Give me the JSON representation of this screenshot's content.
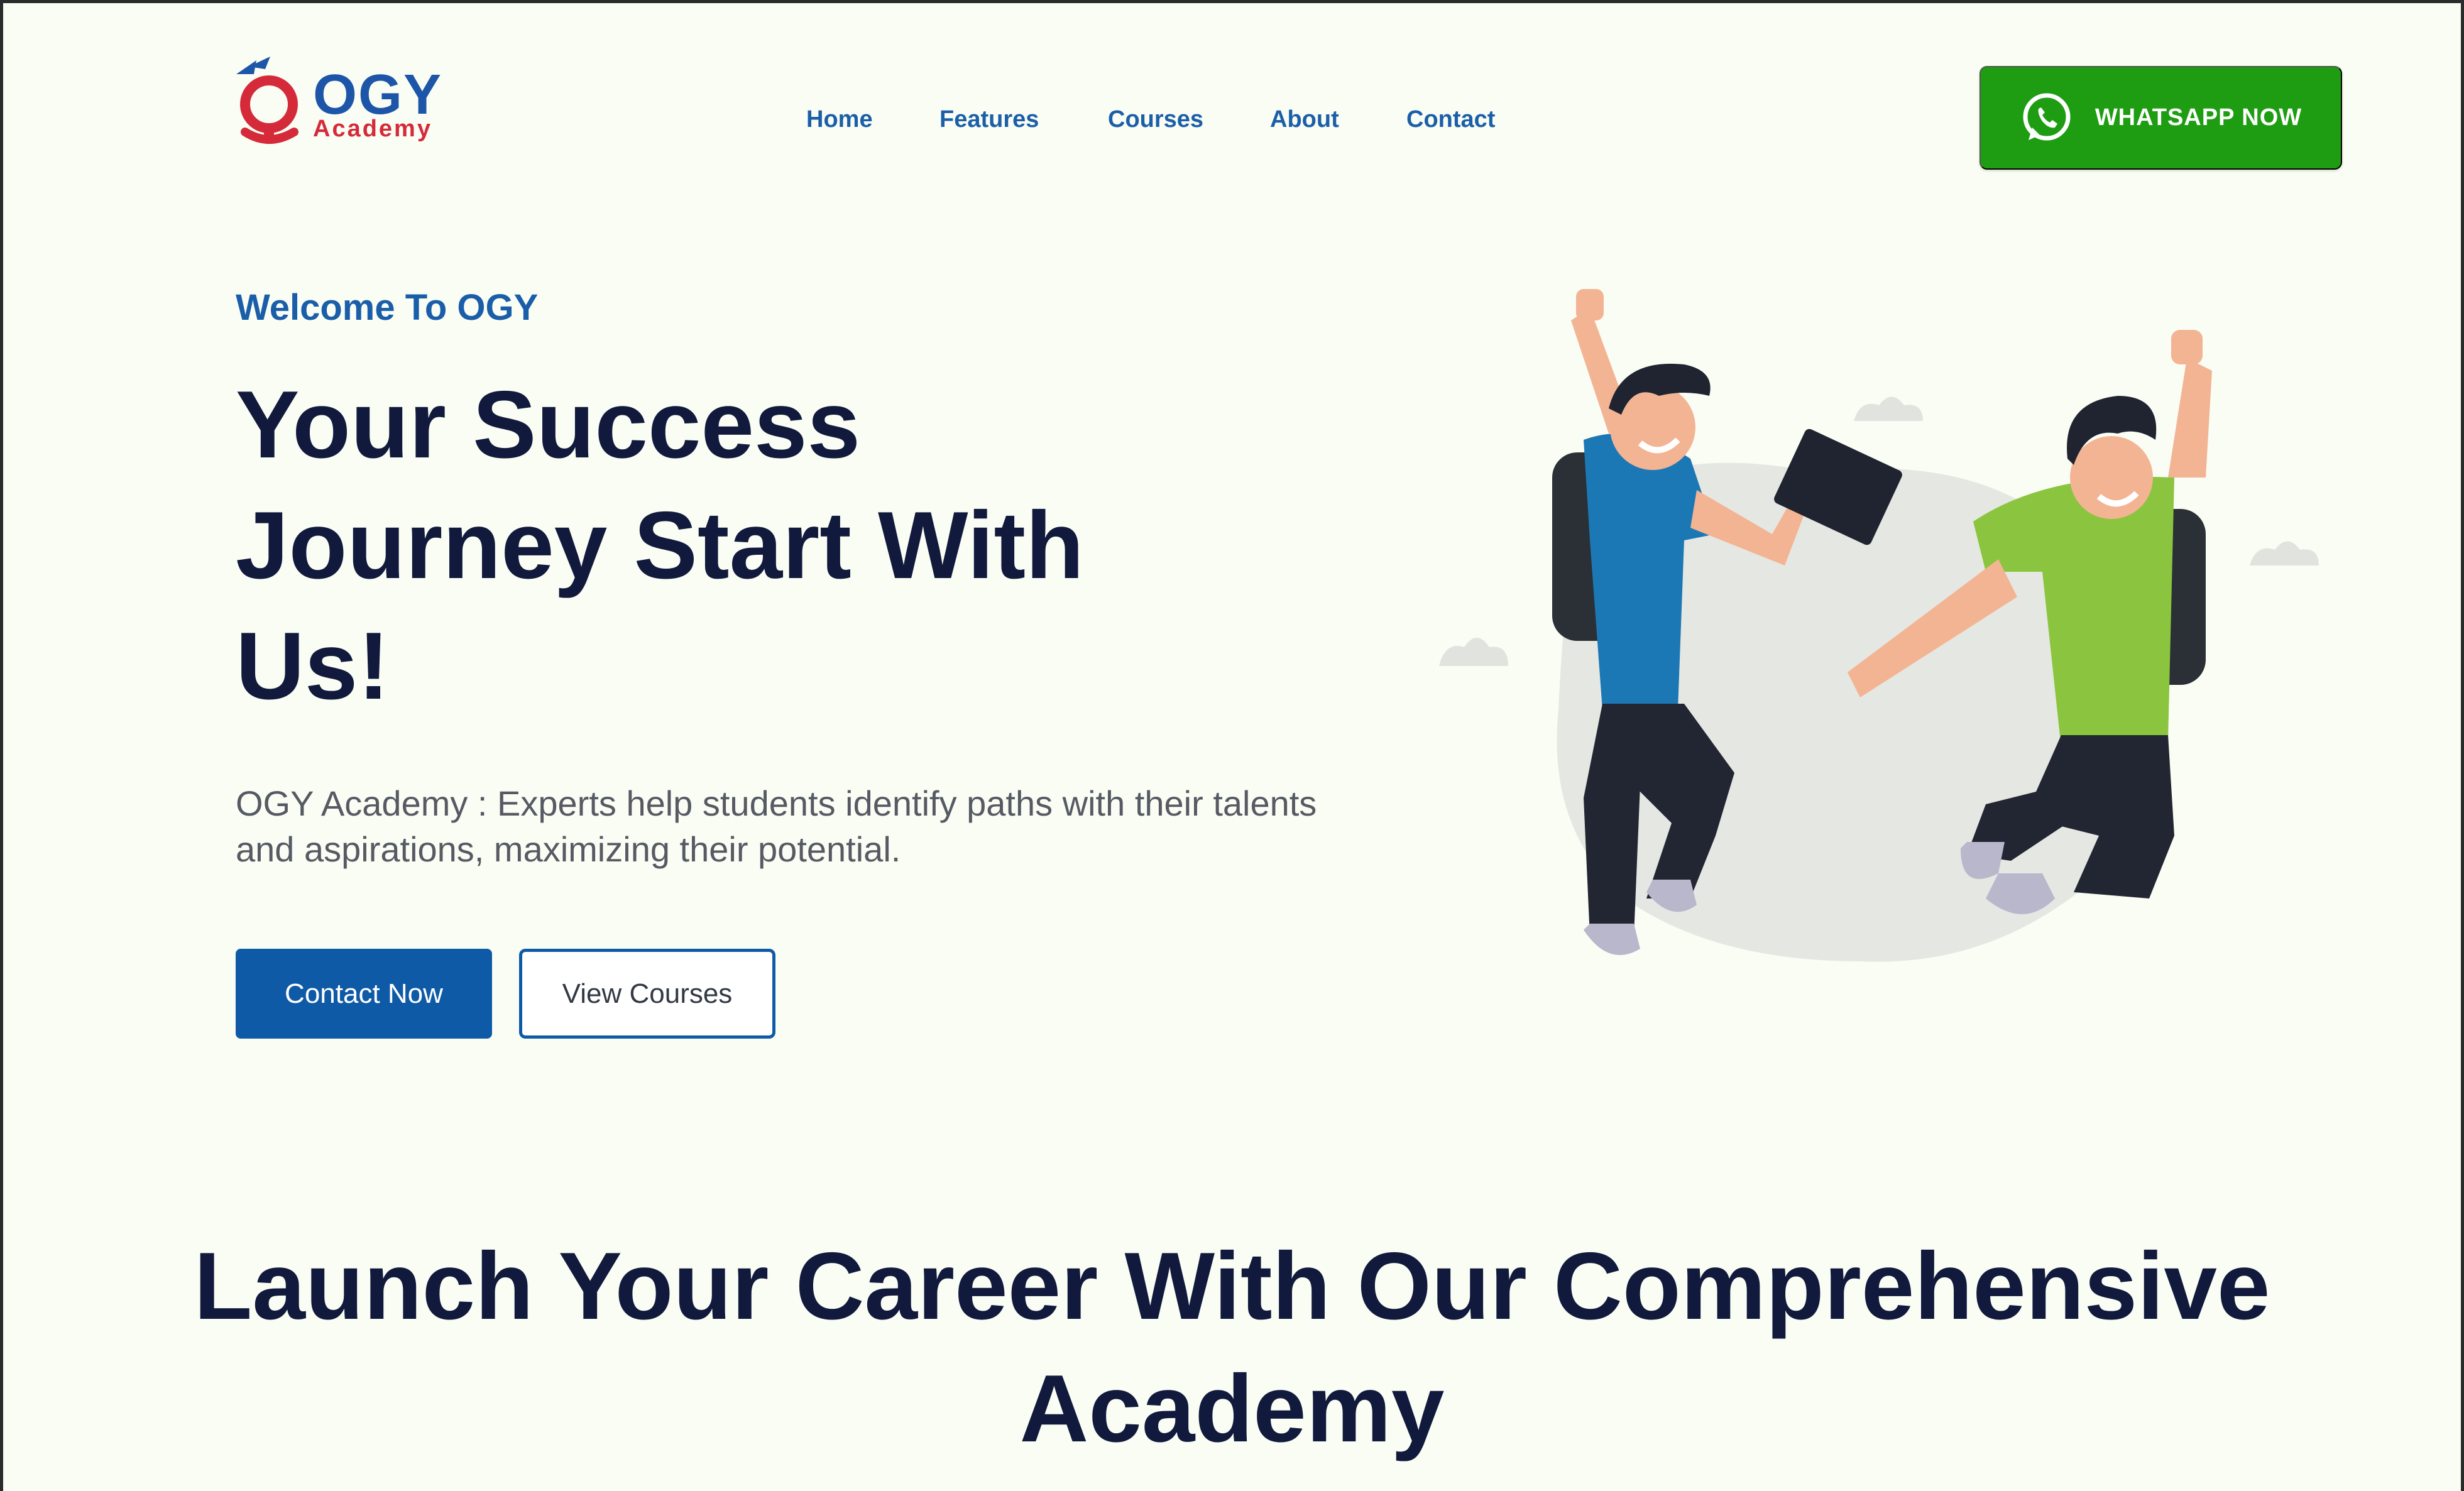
{
  "brand": {
    "name": "OGY",
    "subtitle": "Academy",
    "primary_color": "#1d56a8",
    "accent_color": "#d52a3a"
  },
  "nav": {
    "items": [
      {
        "label": "Home"
      },
      {
        "label": "Features"
      },
      {
        "label": "Courses"
      },
      {
        "label": "About"
      },
      {
        "label": "Contact"
      }
    ],
    "color": "#1b5fa8"
  },
  "cta": {
    "whatsapp_label": "WHATSAPP NOW",
    "whatsapp_icon": "whatsapp-icon",
    "whatsapp_color": "#1e9d12"
  },
  "hero": {
    "eyebrow": "Welcome To OGY",
    "title": "Your Success Journey Start With Us!",
    "description": "OGY Academy : Experts help students identify paths with their talents and aspirations, maximizing their potential.",
    "primary_button": "Contact Now",
    "secondary_button": "View Courses",
    "illustration": "two-students-jumping-illustration"
  },
  "section": {
    "title": "Launch Your Career With Our Comprehensive Academy"
  }
}
